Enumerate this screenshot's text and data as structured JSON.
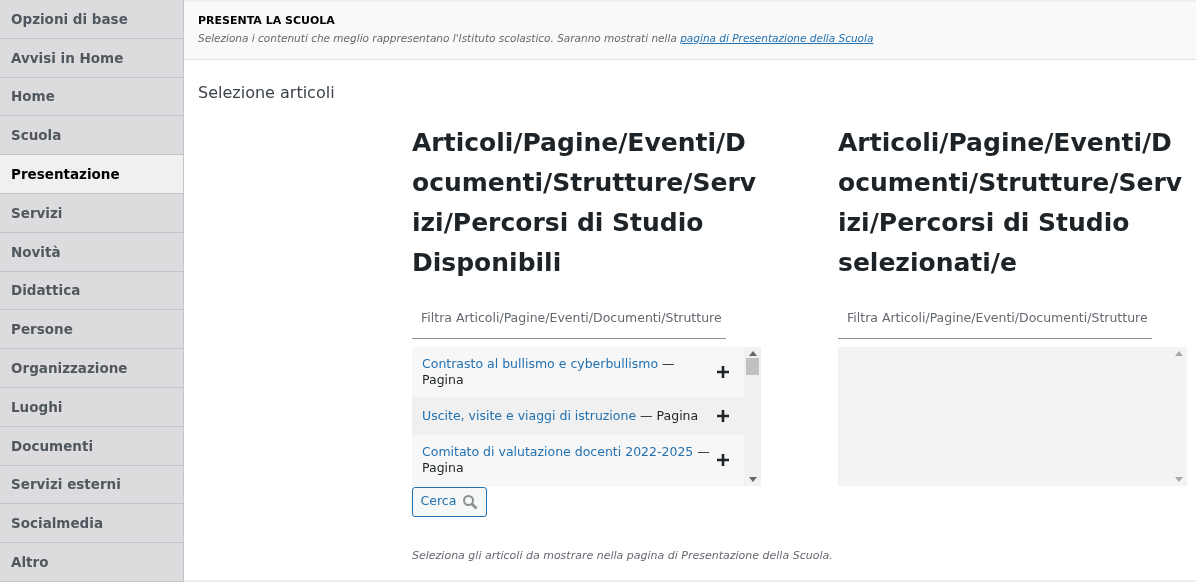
{
  "sidebar": {
    "items": [
      {
        "label": "Opzioni di base",
        "selected": false
      },
      {
        "label": "Avvisi in Home",
        "selected": false
      },
      {
        "label": "Home",
        "selected": false
      },
      {
        "label": "Scuola",
        "selected": false
      },
      {
        "label": "Presentazione",
        "selected": true
      },
      {
        "label": "Servizi",
        "selected": false
      },
      {
        "label": "Novità",
        "selected": false
      },
      {
        "label": "Didattica",
        "selected": false
      },
      {
        "label": "Persone",
        "selected": false
      },
      {
        "label": "Organizzazione",
        "selected": false
      },
      {
        "label": "Luoghi",
        "selected": false
      },
      {
        "label": "Documenti",
        "selected": false
      },
      {
        "label": "Servizi esterni",
        "selected": false
      },
      {
        "label": "Socialmedia",
        "selected": false
      },
      {
        "label": "Altro",
        "selected": false
      }
    ]
  },
  "header": {
    "title": "PRESENTA LA SCUOLA",
    "description": "Seleziona i contenuti che meglio rappresentano l'Istituto scolastico. Saranno mostrati nella",
    "link": "pagina di Presentazione della Scuola"
  },
  "section_title": "Selezione articoli",
  "columns": [
    {
      "heading": "Articoli/Pagine/Eventi/Documenti/Strutture/Servizi/Percorsi di Studio Disponibili",
      "filter_placeholder": "Filtra Articoli/Pagine/Eventi/Documenti/Strutture",
      "items": [
        {
          "title": "Contrasto al bullismo e cyberbullismo",
          "suffix": "— Pagina"
        },
        {
          "title": "Uscite, visite e viaggi di istruzione",
          "suffix": "— Pagina"
        },
        {
          "title": "Comitato di valutazione docenti 2022-2025",
          "suffix": "— Pagina"
        }
      ],
      "search_button": "Cerca"
    },
    {
      "heading": "Articoli/Pagine/Eventi/Documenti/Strutture/Servizi/Percorsi di Studio selezionati/e",
      "filter_placeholder": "Filtra Articoli/Pagine/Eventi/Documenti/Strutture"
    }
  ],
  "note": "Seleziona gli articoli da mostrare nella pagina di Presentazione della Scuola."
}
